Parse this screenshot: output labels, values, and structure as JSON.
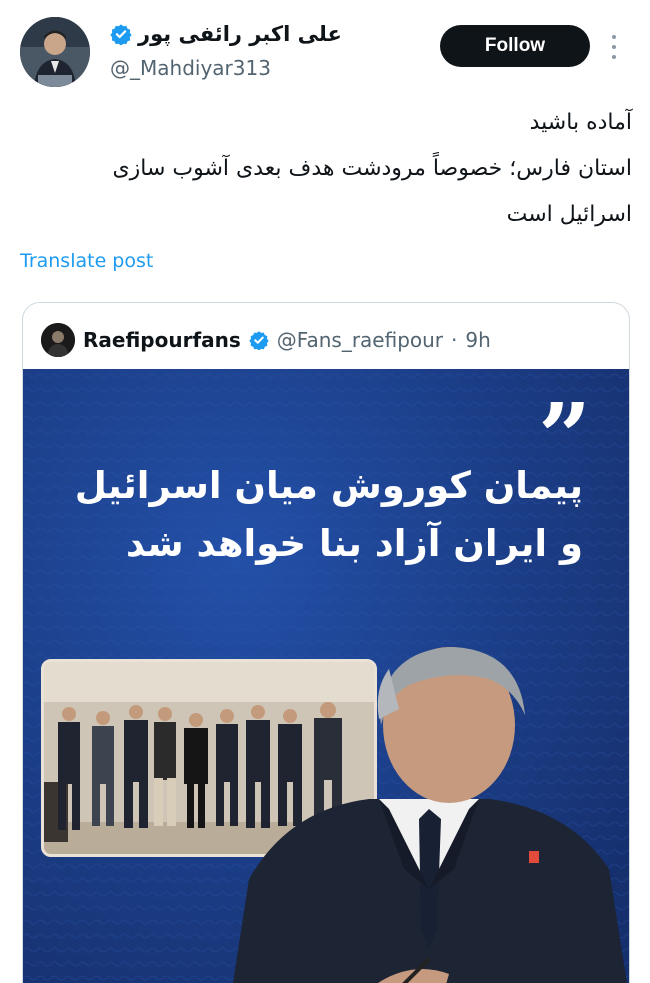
{
  "author": {
    "display_name": "علی اکبر رائفی پور",
    "handle": "@_Mahdiyar313",
    "verified": true
  },
  "actions": {
    "follow_label": "Follow"
  },
  "post": {
    "lines": [
      "آماده باشید",
      "استان فارس؛ خصوصاً مرودشت هدف بعدی آشوب سازی",
      "اسرائیل است"
    ],
    "translate_label": "Translate post"
  },
  "quoted": {
    "name": "Raefipourfans",
    "handle": "@Fans_raefipour",
    "separator": "·",
    "time": "9h",
    "verified": true,
    "image": {
      "quote_mark": "”",
      "headline_lines": [
        "پیمان کوروش میان اسرائیل",
        "و ایران آزاد بنا خواهد شد"
      ]
    }
  },
  "colors": {
    "link_blue": "#1d9bf0",
    "verified_blue": "#1d9bf0",
    "image_background": "#1b3c88",
    "follow_button": "#0f1419"
  }
}
